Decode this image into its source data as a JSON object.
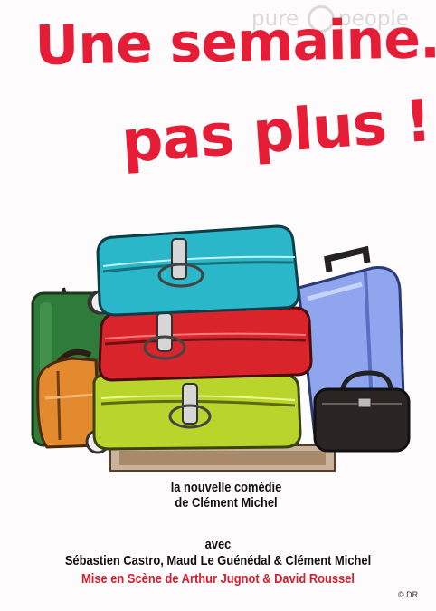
{
  "watermark": {
    "part1": "pure",
    "part2": "people",
    "mark": "®"
  },
  "title": {
    "line1": "Une semaine...",
    "line2": "pas plus !"
  },
  "subtitle": {
    "line1": "la nouvelle comédie",
    "line2": "de Clément Michel"
  },
  "cast": {
    "with_label": "avec",
    "actors": "Sébastien Castro, Maud Le Guénédal & Clément Michel",
    "direction": "Mise en Scène de Arthur Jugnot & David Roussel"
  },
  "credit": "© DR",
  "colors": {
    "title": "#e51d37",
    "direction": "#d11f2f",
    "suitcase_teal": "#2ab7c9",
    "suitcase_red": "#d9242c",
    "suitcase_green": "#b9d42a",
    "suitcase_blue": "#8fa6ee",
    "suitcase_darkgreen": "#2f7b3a",
    "bag_orange": "#e3892e",
    "bag_black": "#2a2523"
  }
}
